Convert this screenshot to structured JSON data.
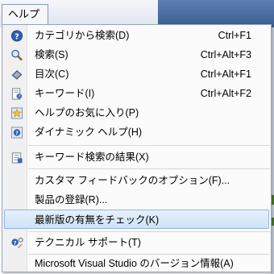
{
  "menu": {
    "title": "ヘルプ(H)",
    "items": [
      {
        "label": "カテゴリから検索(D)",
        "shortcut": "Ctrl+F1",
        "icon": "help-circle-icon"
      },
      {
        "label": "検索(S)",
        "shortcut": "Ctrl+Alt+F3",
        "icon": "magnifier-icon"
      },
      {
        "label": "目次(C)",
        "shortcut": "Ctrl+Alt+F1",
        "icon": "contents-icon"
      },
      {
        "label": "キーワード(I)",
        "shortcut": "Ctrl+Alt+F2",
        "icon": "index-page-icon"
      },
      {
        "label": "ヘルプのお気に入り(P)",
        "shortcut": "",
        "icon": "star-icon"
      },
      {
        "label": "ダイナミック ヘルプ(H)",
        "shortcut": "",
        "icon": "dynamic-help-icon"
      },
      {
        "label": "キーワード検索の結果(X)",
        "shortcut": "",
        "icon": "search-results-icon"
      },
      {
        "label": "カスタマ フィードバックのオプション(F)...",
        "shortcut": "",
        "icon": ""
      },
      {
        "label": "製品の登録(R)...",
        "shortcut": "",
        "icon": ""
      },
      {
        "label": "最新版の有無をチェック(K)",
        "shortcut": "",
        "icon": "",
        "highlighted": true
      },
      {
        "label": "テクニカル サポート(T)",
        "shortcut": "",
        "icon": "support-icon"
      },
      {
        "label": "Microsoft Visual Studio のバージョン情報(A)",
        "shortcut": "",
        "icon": ""
      }
    ]
  },
  "colors": {
    "highlight_border": "#8fb6de",
    "highlight_fill": "#cfe3f7",
    "menu_border": "#97a4b8"
  }
}
